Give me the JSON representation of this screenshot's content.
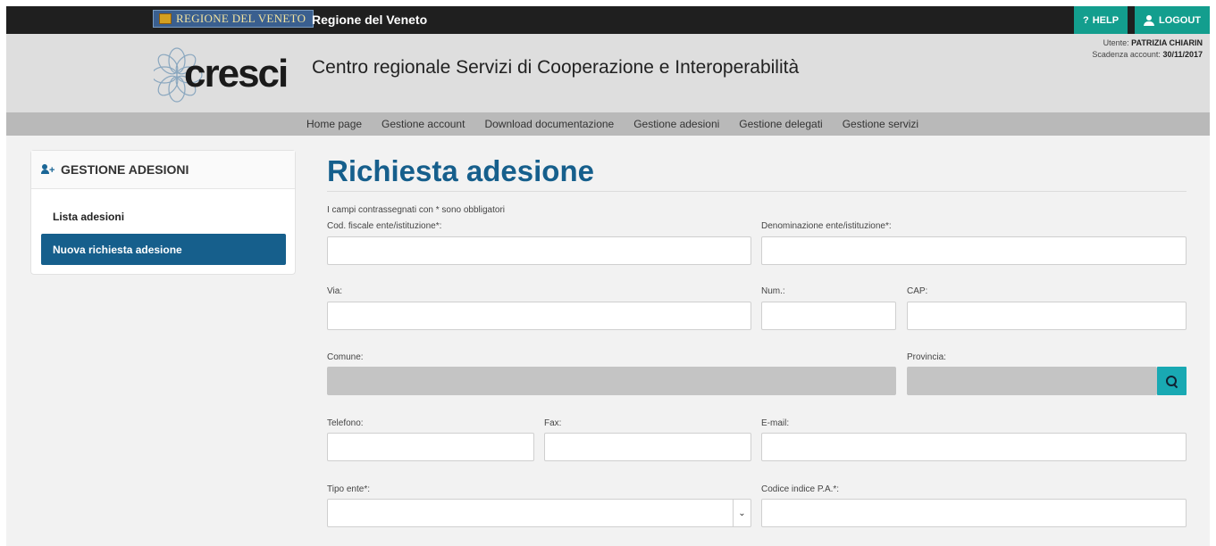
{
  "topbar": {
    "region_logo_text": "REGIONE DEL VENETO",
    "title": "Regione del Veneto",
    "help_label": "HELP",
    "logout_label": "LOGOUT"
  },
  "header": {
    "logo_text": "cresci",
    "title": "Centro regionale Servizi di Cooperazione e Interoperabilità",
    "user_label": "Utente:",
    "user_name": "PATRIZIA CHIARIN",
    "expiry_label": "Scadenza account:",
    "expiry_date": "30/11/2017"
  },
  "nav": {
    "items": [
      "Home page",
      "Gestione account",
      "Download documentazione",
      "Gestione adesioni",
      "Gestione delegati",
      "Gestione servizi"
    ]
  },
  "sidebar": {
    "title": "GESTIONE ADESIONI",
    "items": [
      {
        "label": "Lista adesioni",
        "active": false
      },
      {
        "label": "Nuova richiesta adesione",
        "active": true
      }
    ]
  },
  "form": {
    "title": "Richiesta adesione",
    "note": "I campi contrassegnati con * sono obbligatori",
    "labels": {
      "cod_fiscale": "Cod. fiscale ente/istituzione*:",
      "denominazione": "Denominazione ente/istituzione*:",
      "via": "Via:",
      "num": "Num.:",
      "cap": "CAP:",
      "comune": "Comune:",
      "provincia": "Provincia:",
      "telefono": "Telefono:",
      "fax": "Fax:",
      "email": "E-mail:",
      "tipo_ente": "Tipo ente*:",
      "codice_ipa": "Codice indice P.A.*:"
    },
    "values": {
      "cod_fiscale": "",
      "denominazione": "",
      "via": "",
      "num": "",
      "cap": "",
      "comune": "",
      "provincia": "",
      "telefono": "",
      "fax": "",
      "email": "",
      "tipo_ente": "",
      "codice_ipa": ""
    }
  },
  "colors": {
    "primary": "#165f8c",
    "accent": "#139e8e",
    "search_button": "#19a9b3",
    "topbar": "#1f1f1f",
    "header_bg": "#dedede",
    "nav_bg": "#b9b9b9"
  },
  "icons": {
    "help": "question-icon",
    "logout": "user-icon",
    "sidebar_head": "add-user-icon",
    "search": "search-icon",
    "select": "chevron-down-icon"
  }
}
